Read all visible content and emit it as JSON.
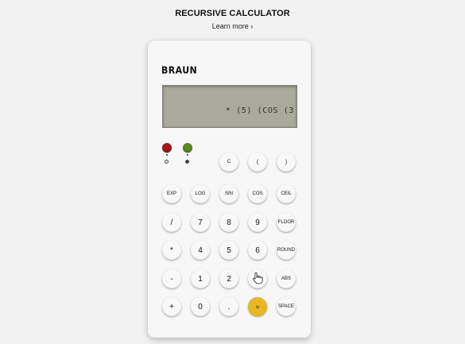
{
  "page": {
    "title": "RECURSIVE CALCULATOR",
    "learn_more": "Learn more ›"
  },
  "calculator": {
    "brand": "BRAUN",
    "display": "* (5) (COS (3",
    "indicators": [
      {
        "name": "red-led",
        "color": "#a31818",
        "selected": false
      },
      {
        "name": "green-led",
        "color": "#5a8a22",
        "selected": true
      }
    ],
    "keys": [
      {
        "id": "clear",
        "label": "C"
      },
      {
        "id": "open-paren",
        "label": "("
      },
      {
        "id": "close-paren",
        "label": ")"
      },
      {
        "id": "exp",
        "label": "EXP"
      },
      {
        "id": "log",
        "label": "LOG"
      },
      {
        "id": "sin",
        "label": "SIN"
      },
      {
        "id": "cos",
        "label": "COS"
      },
      {
        "id": "ceil",
        "label": "CEIL"
      },
      {
        "id": "divide",
        "label": "/"
      },
      {
        "id": "seven",
        "label": "7"
      },
      {
        "id": "eight",
        "label": "8"
      },
      {
        "id": "nine",
        "label": "9"
      },
      {
        "id": "floor",
        "label": "FLOOR"
      },
      {
        "id": "multiply",
        "label": "*"
      },
      {
        "id": "four",
        "label": "4"
      },
      {
        "id": "five",
        "label": "5"
      },
      {
        "id": "six",
        "label": "6"
      },
      {
        "id": "round",
        "label": "ROUND"
      },
      {
        "id": "minus",
        "label": "-"
      },
      {
        "id": "one",
        "label": "1"
      },
      {
        "id": "two",
        "label": "2"
      },
      {
        "id": "three",
        "label": "3"
      },
      {
        "id": "abs",
        "label": "ABS"
      },
      {
        "id": "plus",
        "label": "+"
      },
      {
        "id": "zero",
        "label": "0"
      },
      {
        "id": "decimal",
        "label": "."
      },
      {
        "id": "equals",
        "label": "=",
        "color": "#e8b725"
      },
      {
        "id": "space",
        "label": "SPACE"
      }
    ]
  }
}
